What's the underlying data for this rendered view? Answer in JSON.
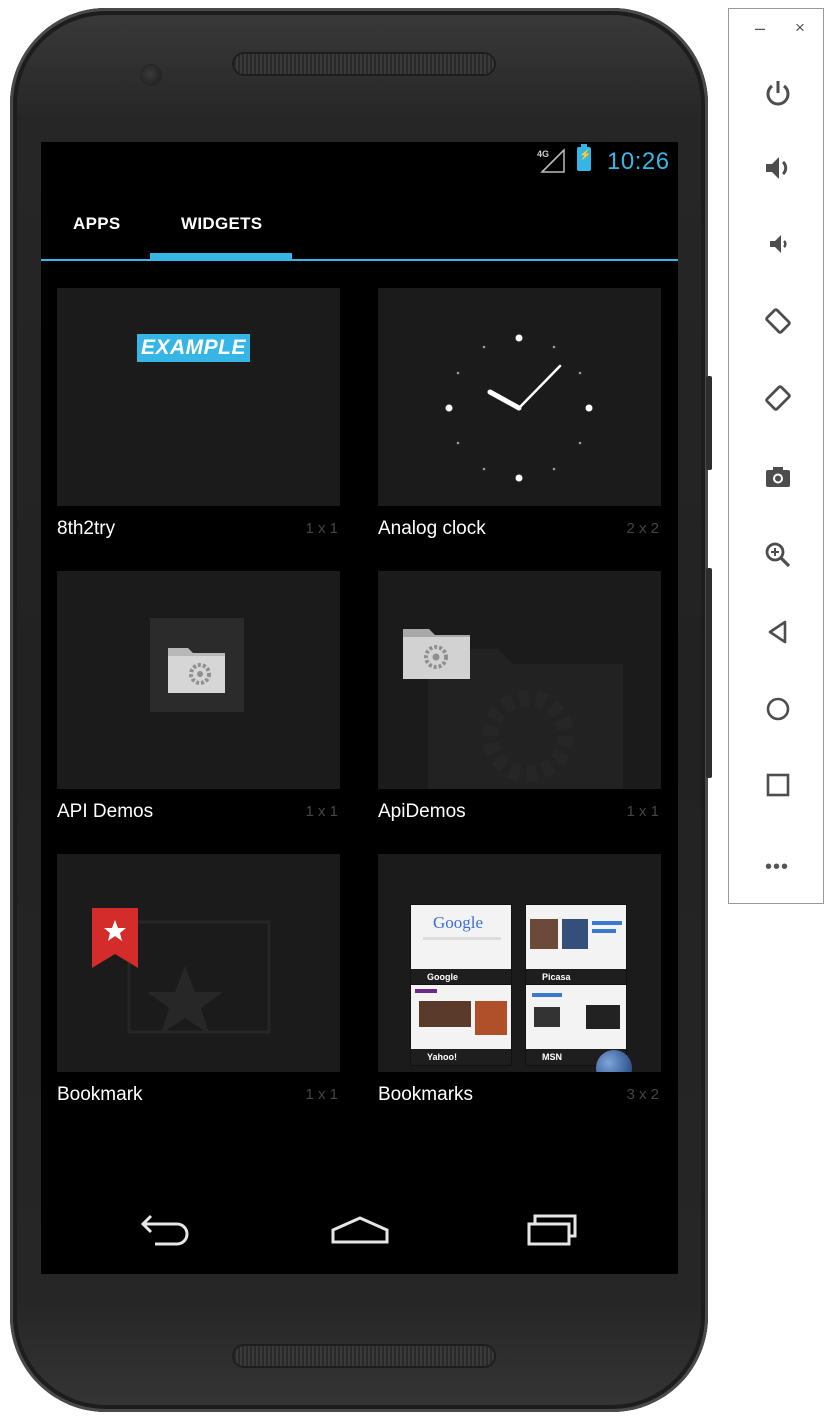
{
  "status_bar": {
    "time": "10:26",
    "network": "4G"
  },
  "tabs": [
    {
      "label": "APPS",
      "selected": false
    },
    {
      "label": "WIDGETS",
      "selected": true
    }
  ],
  "widgets": [
    {
      "name": "8th2try",
      "size": "1 x 1",
      "preview_text": "EXAMPLE"
    },
    {
      "name": "Analog clock",
      "size": "2 x 2"
    },
    {
      "name": "API Demos",
      "size": "1 x 1"
    },
    {
      "name": "ApiDemos",
      "size": "1 x 1"
    },
    {
      "name": "Bookmark",
      "size": "1 x 1"
    },
    {
      "name": "Bookmarks",
      "size": "3 x 2",
      "thumbnails": [
        {
          "label": "Google",
          "logo": "Google"
        },
        {
          "label": "Picasa"
        },
        {
          "label": "Yahoo!"
        },
        {
          "label": "MSN"
        }
      ]
    }
  ],
  "nav_bar": {
    "buttons": [
      "back-icon",
      "home-icon",
      "recents-icon"
    ]
  },
  "toolbar": {
    "minimize": "–",
    "close": "×",
    "more": "•••",
    "buttons": [
      "power-icon",
      "volume-up-icon",
      "volume-down-icon",
      "rotate-left-icon",
      "rotate-right-icon",
      "camera-icon",
      "zoom-icon",
      "back-icon",
      "home-icon",
      "overview-icon"
    ]
  },
  "colors": {
    "accent": "#36b6e6",
    "screen_bg": "#000000",
    "widget_bg": "#1b1b1b",
    "phone_body": "#222222"
  }
}
